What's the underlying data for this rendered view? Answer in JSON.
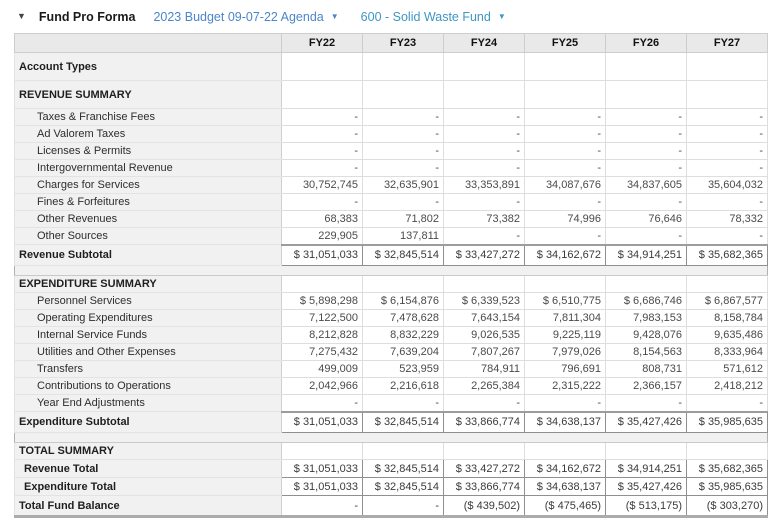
{
  "header": {
    "collapse_icon": "▼",
    "title": "Fund Pro Forma",
    "budget_dropdown": {
      "label": "2023 Budget 09-07-22 Agenda",
      "caret": "▼"
    },
    "fund_dropdown": {
      "label": "600 - Solid Waste Fund",
      "caret": "▼"
    }
  },
  "colors": {
    "budget_dropdown_blue": "#4a86c8",
    "fund_dropdown_teal": "#3e96c4",
    "label_column_bg": "#f1f1f1",
    "header_row_bg": "#e9e9e9"
  },
  "table": {
    "columns": [
      "FY22",
      "FY23",
      "FY24",
      "FY25",
      "FY26",
      "FY27"
    ],
    "rows": [
      {
        "type": "tall",
        "label": "Account Types",
        "values": [
          "",
          "",
          "",
          "",
          "",
          ""
        ]
      },
      {
        "type": "section-lg",
        "label": "REVENUE SUMMARY",
        "values": [
          "",
          "",
          "",
          "",
          "",
          ""
        ]
      },
      {
        "type": "detail",
        "label": "Taxes & Franchise Fees",
        "values": [
          "-",
          "-",
          "-",
          "-",
          "-",
          "-"
        ]
      },
      {
        "type": "detail",
        "label": "Ad Valorem Taxes",
        "values": [
          "-",
          "-",
          "-",
          "-",
          "-",
          "-"
        ]
      },
      {
        "type": "detail",
        "label": "Licenses & Permits",
        "values": [
          "-",
          "-",
          "-",
          "-",
          "-",
          "-"
        ]
      },
      {
        "type": "detail",
        "label": "Intergovernmental Revenue",
        "values": [
          "-",
          "-",
          "-",
          "-",
          "-",
          "-"
        ]
      },
      {
        "type": "detail",
        "label": "Charges for Services",
        "values": [
          "30,752,745",
          "32,635,901",
          "33,353,891",
          "34,087,676",
          "34,837,605",
          "35,604,032"
        ]
      },
      {
        "type": "detail",
        "label": "Fines & Forfeitures",
        "values": [
          "-",
          "-",
          "-",
          "-",
          "-",
          "-"
        ]
      },
      {
        "type": "detail",
        "label": "Other Revenues",
        "values": [
          "68,383",
          "71,802",
          "73,382",
          "74,996",
          "76,646",
          "78,332"
        ]
      },
      {
        "type": "detail",
        "label": "Other Sources",
        "values": [
          "229,905",
          "137,811",
          "-",
          "-",
          "-",
          "-"
        ]
      },
      {
        "type": "subtotal",
        "label": "Revenue Subtotal",
        "values": [
          "$ 31,051,033",
          "$ 32,845,514",
          "$ 33,427,272",
          "$ 34,162,672",
          "$ 34,914,251",
          "$ 35,682,365"
        ]
      },
      {
        "type": "separator"
      },
      {
        "type": "section",
        "label": "EXPENDITURE SUMMARY",
        "values": [
          "",
          "",
          "",
          "",
          "",
          ""
        ]
      },
      {
        "type": "detail",
        "label": "Personnel Services",
        "values": [
          "$ 5,898,298",
          "$ 6,154,876",
          "$ 6,339,523",
          "$ 6,510,775",
          "$ 6,686,746",
          "$ 6,867,577"
        ]
      },
      {
        "type": "detail",
        "label": "Operating Expenditures",
        "values": [
          "7,122,500",
          "7,478,628",
          "7,643,154",
          "7,811,304",
          "7,983,153",
          "8,158,784"
        ]
      },
      {
        "type": "detail",
        "label": "Internal Service Funds",
        "values": [
          "8,212,828",
          "8,832,229",
          "9,026,535",
          "9,225,119",
          "9,428,076",
          "9,635,486"
        ]
      },
      {
        "type": "detail",
        "label": "Utilities and Other Expenses",
        "values": [
          "7,275,432",
          "7,639,204",
          "7,807,267",
          "7,979,026",
          "8,154,563",
          "8,333,964"
        ]
      },
      {
        "type": "detail",
        "label": "Transfers",
        "values": [
          "499,009",
          "523,959",
          "784,911",
          "796,691",
          "808,731",
          "571,612"
        ]
      },
      {
        "type": "detail",
        "label": "Contributions to Operations",
        "values": [
          "2,042,966",
          "2,216,618",
          "2,265,384",
          "2,315,222",
          "2,366,157",
          "2,418,212"
        ]
      },
      {
        "type": "detail",
        "label": "Year End Adjustments",
        "values": [
          "-",
          "-",
          "-",
          "-",
          "-",
          "-"
        ]
      },
      {
        "type": "subtotal",
        "label": "Expenditure Subtotal",
        "values": [
          "$ 31,051,033",
          "$ 32,845,514",
          "$ 33,866,774",
          "$ 34,638,137",
          "$ 35,427,426",
          "$ 35,985,635"
        ]
      },
      {
        "type": "separator"
      },
      {
        "type": "section",
        "label": "TOTAL SUMMARY",
        "values": [
          "",
          "",
          "",
          "",
          "",
          ""
        ]
      },
      {
        "type": "total",
        "label": "Revenue Total",
        "values": [
          "$ 31,051,033",
          "$ 32,845,514",
          "$ 33,427,272",
          "$ 34,162,672",
          "$ 34,914,251",
          "$ 35,682,365"
        ]
      },
      {
        "type": "total",
        "label": "Expenditure Total",
        "values": [
          "$ 31,051,033",
          "$ 32,845,514",
          "$ 33,866,774",
          "$ 34,638,137",
          "$ 35,427,426",
          "$ 35,985,635"
        ]
      },
      {
        "type": "grandtotal",
        "label": "Total Fund Balance",
        "values": [
          "-",
          "-",
          "($ 439,502)",
          "($ 475,465)",
          "($ 513,175)",
          "($ 303,270)"
        ]
      }
    ]
  }
}
